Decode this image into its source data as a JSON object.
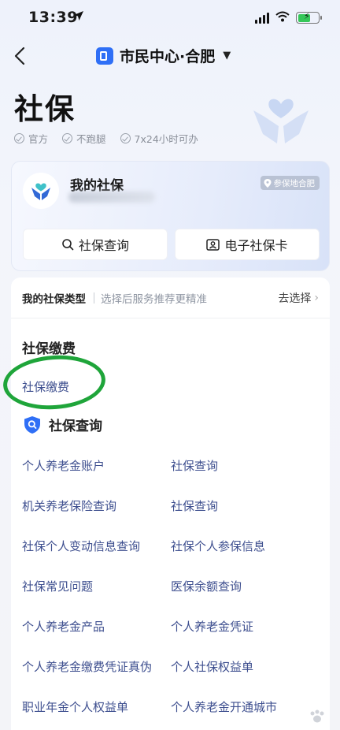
{
  "status_bar": {
    "time": "13:39"
  },
  "nav": {
    "city": "市民中心·合肥"
  },
  "header": {
    "title": "社保",
    "tags": [
      "官方",
      "不跑腿",
      "7x24小时可办"
    ]
  },
  "my_card": {
    "title": "我的社保",
    "location_badge": "参保地合肥",
    "buttons": [
      {
        "label": "社保查询",
        "icon": "search-icon"
      },
      {
        "label": "电子社保卡",
        "icon": "id-card-icon"
      }
    ]
  },
  "type_row": {
    "label": "我的社保类型",
    "hint": "选择后服务推荐更精准",
    "action": "去选择"
  },
  "payment_section": {
    "title": "社保缴费",
    "link": "社保缴费"
  },
  "query_section": {
    "title": "社保查询",
    "items": [
      "个人养老金账户",
      "社保查询",
      "机关养老保险查询",
      "社保查询",
      "社保个人变动信息查询",
      "社保个人参保信息",
      "社保常见问题",
      "医保余额查询",
      "个人养老金产品",
      "个人养老金凭证",
      "个人养老金缴费凭证真伪",
      "个人社保权益单",
      "职业年金个人权益单",
      "个人养老金开通城市"
    ]
  },
  "colors": {
    "accent": "#2f6ff6",
    "link": "#3e4f8f",
    "annotation": "#1fa53a"
  }
}
